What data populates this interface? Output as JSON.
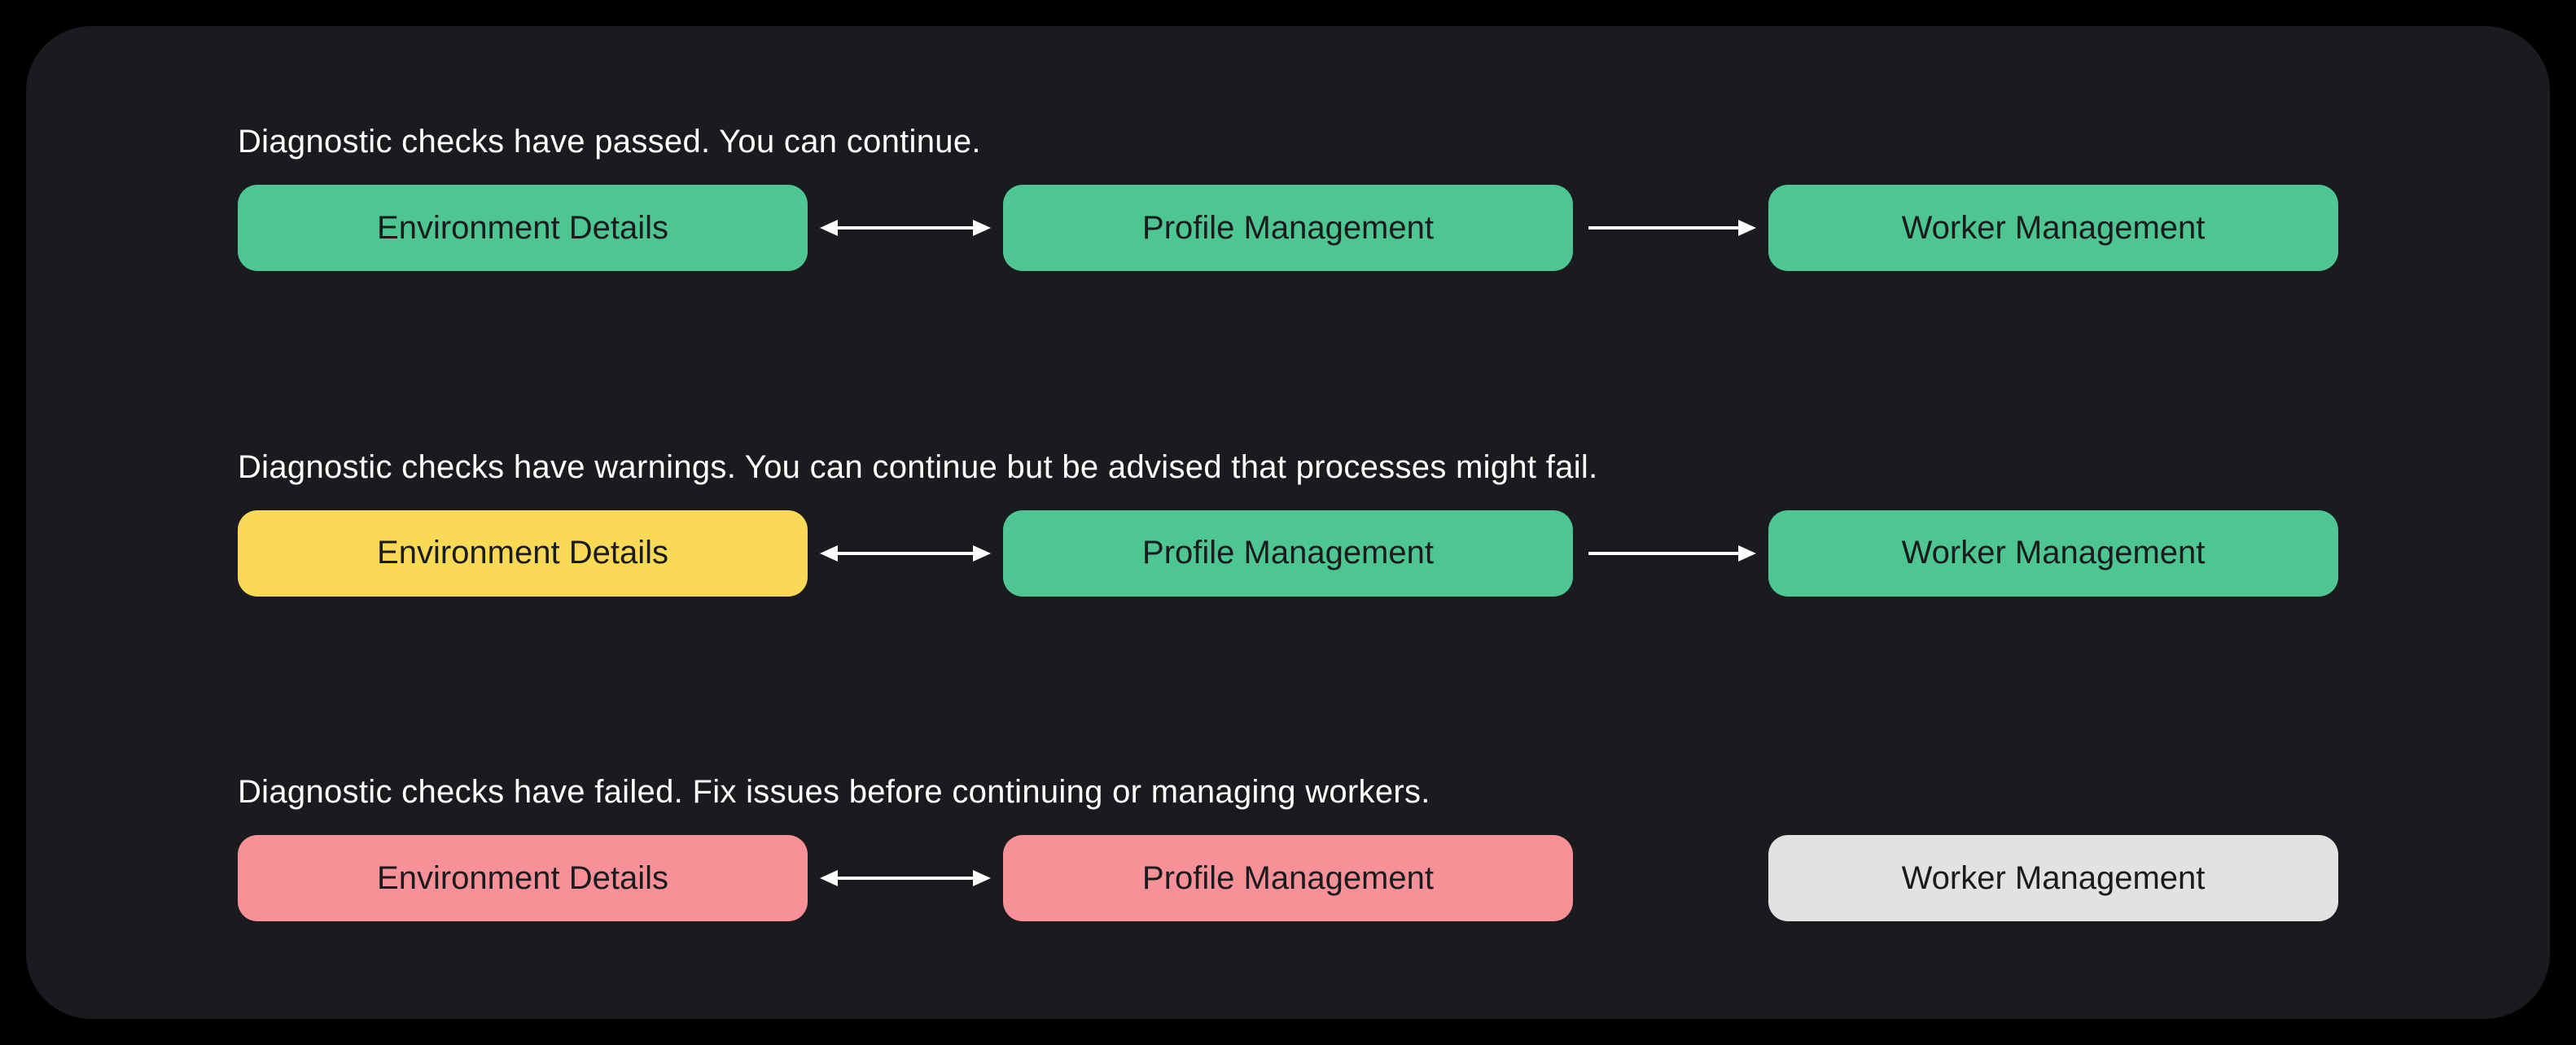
{
  "rows": [
    {
      "label": "Diagnostic checks have passed. You can continue.",
      "nodes": [
        {
          "text": "Environment Details",
          "status": "green"
        },
        {
          "text": "Profile Management",
          "status": "green"
        },
        {
          "text": "Worker Management",
          "status": "green"
        }
      ],
      "connectors": [
        "double",
        "right"
      ]
    },
    {
      "label": "Diagnostic checks have warnings. You can continue but be advised that processes might fail.",
      "nodes": [
        {
          "text": "Environment Details",
          "status": "yellow"
        },
        {
          "text": "Profile Management",
          "status": "green"
        },
        {
          "text": "Worker Management",
          "status": "green"
        }
      ],
      "connectors": [
        "double",
        "right"
      ]
    },
    {
      "label": "Diagnostic checks have failed. Fix issues before continuing or managing workers.",
      "nodes": [
        {
          "text": "Environment Details",
          "status": "red"
        },
        {
          "text": "Profile Management",
          "status": "red"
        },
        {
          "text": "Worker Management",
          "status": "grey"
        }
      ],
      "connectors": [
        "double",
        "none"
      ]
    }
  ],
  "colors": {
    "green": "#4dc692",
    "yellow": "#f9d955",
    "red": "#f79097",
    "grey": "#e2e2e2",
    "panel": "#1a1b1e",
    "text": "#ffffff"
  }
}
